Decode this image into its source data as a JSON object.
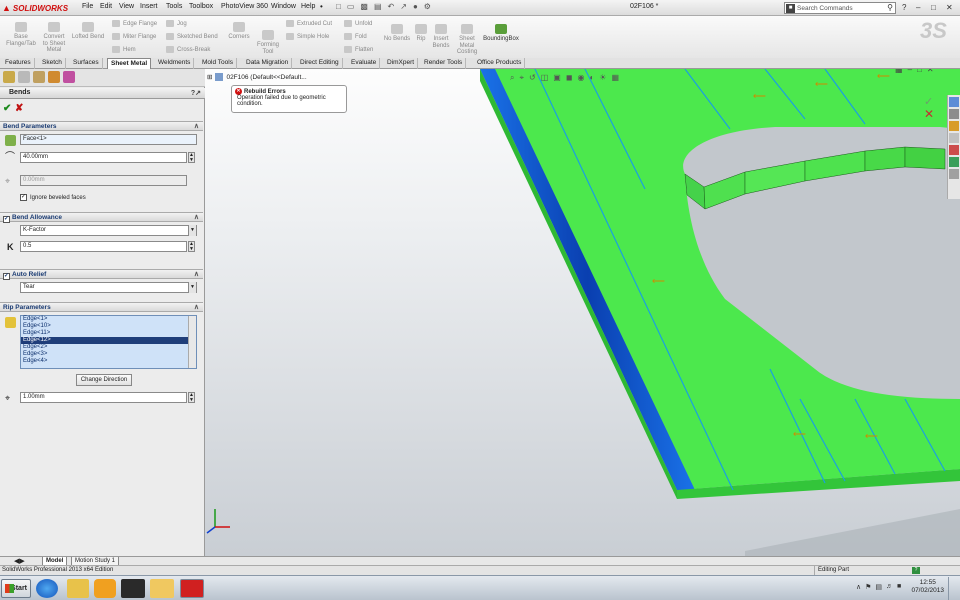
{
  "app": {
    "name": "SOLIDWORKS",
    "document_title": "02F106 *"
  },
  "menu": [
    "File",
    "Edit",
    "View",
    "Insert",
    "Tools",
    "Toolbox",
    "PhotoView 360",
    "Window",
    "Help"
  ],
  "search": {
    "placeholder": "Search Commands"
  },
  "command_manager": {
    "tools": [
      {
        "label": "Base\nFlange/Tab"
      },
      {
        "label": "Convert\nto Sheet\nMetal"
      },
      {
        "label": "Lofted Bend"
      },
      {
        "label": "Corners"
      },
      {
        "label": "Forming\nTool"
      },
      {
        "label": "Unfold"
      },
      {
        "label": "Fold"
      },
      {
        "label": "Flatten"
      },
      {
        "label": "No Bends"
      },
      {
        "label": "Rip"
      },
      {
        "label": "Insert\nBends"
      },
      {
        "label": "Sheet\nMetal\nCosting"
      },
      {
        "label": "BoundingBox"
      }
    ],
    "small_tools": [
      "Edge Flange",
      "Miter Flange",
      "Hem",
      "Jog",
      "Sketched Bend",
      "Cross-Break",
      "Extruded Cut",
      "Simple Hole"
    ]
  },
  "tabs": [
    "Features",
    "Sketch",
    "Surfaces",
    "Sheet Metal",
    "Weldments",
    "Mold Tools",
    "Data Migration",
    "Direct Editing",
    "Evaluate",
    "DimXpert",
    "Render Tools",
    "Office Products"
  ],
  "active_tab": "Sheet Metal",
  "property_manager": {
    "title": "Bends",
    "bend_parameters": {
      "header": "Bend Parameters",
      "face": "Face<1>",
      "radius": "40.00mm",
      "disabled_value": "0.00mm",
      "ignore_beveled_label": "Ignore beveled faces"
    },
    "bend_allowance": {
      "header": "Bend Allowance",
      "type": "K-Factor",
      "k_label": "K",
      "k_value": "0.5"
    },
    "auto_relief": {
      "header": "Auto Relief",
      "type": "Tear"
    },
    "rip_parameters": {
      "header": "Rip Parameters",
      "edges": [
        "Edge<1>",
        "Edge<10>",
        "Edge<11>",
        "Edge<12>",
        "Edge<2>",
        "Edge<3>",
        "Edge<4>"
      ],
      "selected_edge": "Edge<12>",
      "change_direction": "Change Direction",
      "gap": "1.00mm"
    }
  },
  "viewport": {
    "tree_item": "02F106 (Default<<Default...",
    "rebuild": {
      "title": "Rebuild Errors",
      "message": "Operation failed due to geometric condition."
    },
    "colors": {
      "part_face": "#4de84d",
      "part_side": "#33c233",
      "bend_line": "#1aa0e0",
      "selected": "#1565d8"
    }
  },
  "bottom_tabs": [
    "Model",
    "Motion Study 1"
  ],
  "status": {
    "left": "SolidWorks Professional 2013 x64 Edition",
    "right": "Editing Part"
  },
  "taskbar": {
    "start": "Start",
    "time": "12:55",
    "date": "07/02/2013"
  }
}
